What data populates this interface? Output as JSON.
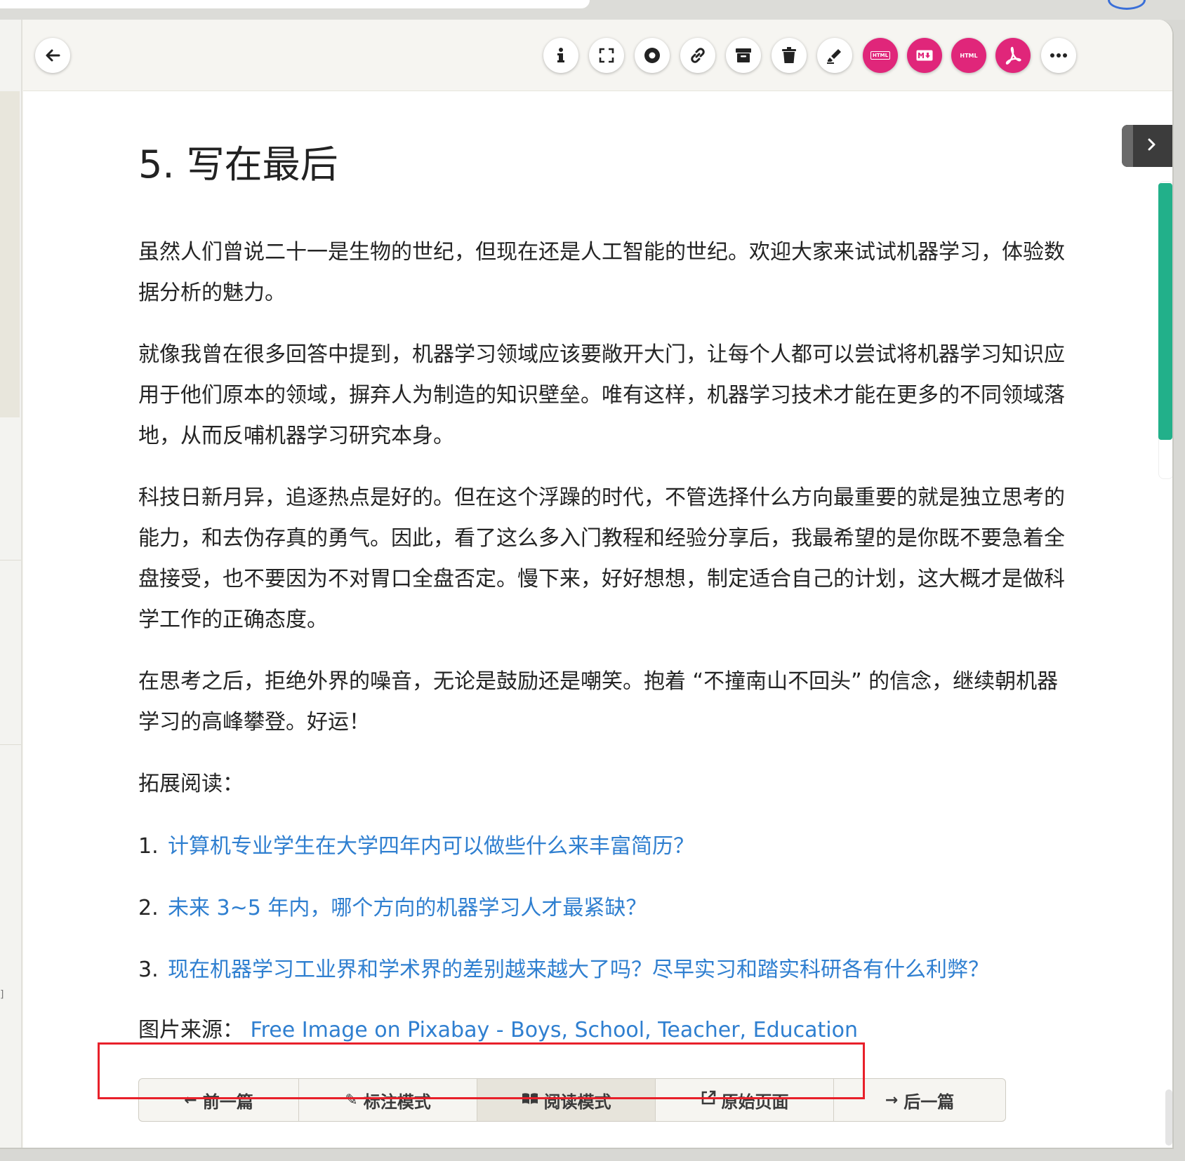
{
  "toolbar": {
    "back_icon": "arrow-left-icon",
    "buttons": [
      {
        "name": "info-button",
        "icon": "info-icon"
      },
      {
        "name": "fullscreen-button",
        "icon": "expand-icon"
      },
      {
        "name": "record-button",
        "icon": "circle-dot-icon"
      },
      {
        "name": "link-button",
        "icon": "link-icon"
      },
      {
        "name": "archive-button",
        "icon": "archive-icon"
      },
      {
        "name": "delete-button",
        "icon": "trash-icon"
      },
      {
        "name": "highlight-button",
        "icon": "highlighter-icon"
      },
      {
        "name": "export-html-button",
        "icon": "html-icon"
      },
      {
        "name": "export-markdown-button",
        "icon": "markdown-icon"
      },
      {
        "name": "export-html2-button",
        "icon": "html-text-icon"
      },
      {
        "name": "export-pdf-button",
        "icon": "pdf-icon"
      },
      {
        "name": "more-button",
        "icon": "ellipsis-icon"
      }
    ],
    "accent_color": "#e0267a"
  },
  "article": {
    "heading": "5. 写在最后",
    "paragraphs": [
      "虽然人们曾说二十一是生物的世纪，但现在还是人工智能的世纪。欢迎大家来试试机器学习，体验数据分析的魅力。",
      "就像我曾在很多回答中提到，机器学习领域应该要敞开大门，让每个人都可以尝试将机器学习知识应用于他们原本的领域，摒弃人为制造的知识壁垒。唯有这样，机器学习技术才能在更多的不同领域落地，从而反哺机器学习研究本身。",
      "科技日新月异，追逐热点是好的。但在这个浮躁的时代，不管选择什么方向最重要的就是独立思考的能力，和去伪存真的勇气。因此，看了这么多入门教程和经验分享后，我最希望的是你既不要急着全盘接受，也不要因为不对胃口全盘否定。慢下来，好好想想，制定适合自己的计划，这大概才是做科学工作的正确态度。",
      "在思考之后，拒绝外界的噪音，无论是鼓励还是嘲笑。抱着 “不撞南山不回头” 的信念，继续朝机器学习的高峰攀登。好运！"
    ],
    "further_reading_label": "拓展阅读：",
    "links": [
      {
        "num": "1.",
        "text": "计算机专业学生在大学四年内可以做些什么来丰富简历？"
      },
      {
        "num": "2.",
        "text": "未来 3~5 年内，哪个方向的机器学习人才最紧缺？"
      },
      {
        "num": "3.",
        "text": "现在机器学习工业界和学术界的差别越来越大了吗？尽早实习和踏实科研各有什么利弊？"
      }
    ],
    "image_source_label": "图片来源：",
    "image_source_link": "Free Image on Pixabay - Boys, School, Teacher, Education",
    "link_color": "#2f7fd0"
  },
  "navbar": {
    "prev": "前一篇",
    "annotate": "标注模式",
    "read": "阅读模式",
    "original": "原始页面",
    "next": "后一篇",
    "prev_icon": "arrow-left-icon",
    "annotate_icon": "pen-icon",
    "read_icon": "book-icon",
    "original_icon": "external-link-icon",
    "next_icon": "arrow-right-icon"
  },
  "side_panel": {
    "toggle_icon": "chevron-right-icon",
    "reading_progress": 0.86,
    "progress_color": "#22b08a"
  }
}
